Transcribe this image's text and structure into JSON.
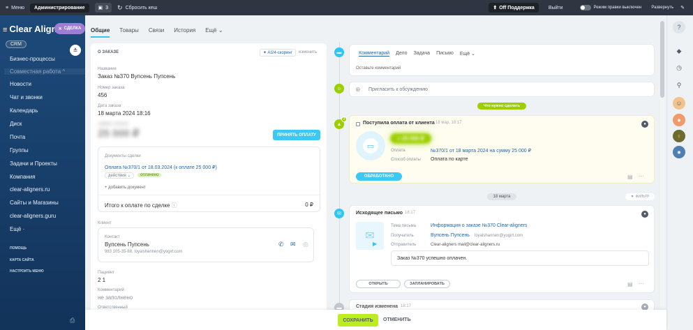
{
  "topbar": {
    "menu_label": "Меню",
    "admin_label": "Администрирование",
    "badge_count": "3",
    "reset_cache_label": "Сбросить кеш",
    "support_label": "Off Поддержка",
    "exit_label": "Выйти",
    "edit_mode_label": "Режим правки выключен",
    "expand_label": "Развернуть"
  },
  "sidebar": {
    "logo": "Clear Align",
    "deal_label": "СДЕЛКА",
    "crm_tag": "CRM",
    "items": [
      {
        "label": "Бизнес-процессы"
      },
      {
        "label": "Совместная работа ^"
      },
      {
        "label": "Новости"
      },
      {
        "label": "Чат и звонки"
      },
      {
        "label": "Календарь"
      },
      {
        "label": "Диск"
      },
      {
        "label": "Почта"
      },
      {
        "label": "Группы"
      },
      {
        "label": "Задачи и Проекты"
      },
      {
        "label": "Компания"
      },
      {
        "label": "clear-aligners.ru"
      },
      {
        "label": "Сайты и Магазины"
      },
      {
        "label": "clear-aligners.guru"
      },
      {
        "label": "Ещё ·"
      }
    ],
    "footer": [
      "ПОМОЩЬ",
      "КАРТА САЙТА",
      "НАСТРОИТЬ МЕНЮ"
    ]
  },
  "tabs": [
    "Общие",
    "Товары",
    "Связи",
    "История",
    "Ещё ⌄"
  ],
  "order": {
    "section_title": "О ЗАКАЗЕ",
    "ai_scoring": "AI24-скоринг",
    "edit_label": "изменить",
    "name_label": "Название",
    "name_value": "Заказ №370 Вупсень Пупсень",
    "number_label": "Номер заказа",
    "number_value": "456",
    "date_label": "Дата заказа",
    "date_value": "18 марта 2024 18:16",
    "sum_label": "Сумма к оплате",
    "sum_value": "25 000 ₽",
    "accept_payment": "ПРИНЯТЬ ОПЛАТУ",
    "docs_label": "Документы сделки",
    "doc_link": "Оплата №370/1 от 18.03.2024 (к оплате 25 000 ₽)",
    "doc_actions": "действия ⌄",
    "doc_status": "оплачено",
    "add_doc": "+ добавить документ",
    "total_label": "Итого к оплате по сделке",
    "total_value": "0 ₽",
    "client_label": "Клиент",
    "contact_label": "Контакт",
    "contact_name": "Вупсень Пупсень",
    "contact_details": "983 105-35-88, loyalshannen@yogirt.com",
    "patient_label": "Пациент",
    "patient_value": "2 1",
    "comment_label": "Комментарий",
    "comment_value": "не заполнено",
    "responsible_label": "Ответственный"
  },
  "activity": {
    "tabs": [
      "Комментарий",
      "Дело",
      "Задача",
      "Письмо",
      "Ещё ⌄"
    ],
    "placeholder": "Оставьте комментарий",
    "invite": "Пригласить к обсуждению",
    "todo_pill": "Что нужно сделать"
  },
  "payment_card": {
    "badge": "3",
    "title": "Поступила оплата от клиента",
    "time": "18 мар, 18:17",
    "amount": "+ 25 000 ₽",
    "payment_label": "Оплата",
    "payment_value": "№370/1 от 18 марта 2024 на сумму 25 000 ₽",
    "method_label": "Способ оплаты",
    "method_value": "Оплата по карте",
    "processed_button": "ОБРАБОТАНО"
  },
  "date_separator": "18 марта",
  "filter_label": "ФИЛЬТР",
  "email_card": {
    "title": "Исходящее письмо",
    "time": "18:17",
    "subject_label": "Тема письма",
    "subject_value": "Информация о заказе №370 Clear-aligners",
    "recipient_label": "Получатель",
    "recipient_name": "Вупсень Пупсень",
    "recipient_email": "loyalshannen@yogirt.com",
    "sender_label": "Отправитель",
    "sender_value": "Clear-aligners mail@clear-aligners.ru",
    "body": "Заказ №370 успешно оплачен.",
    "open_button": "ОТКРЫТЬ",
    "schedule_button": "ЗАПЛАНИРОВАТЬ"
  },
  "stage_card": {
    "title": "Стадия изменена",
    "time": "18:17"
  },
  "bottom": {
    "save": "СОХРАНИТЬ",
    "cancel": "ОТМЕНИТЬ"
  },
  "colors": {
    "accent": "#2fc6f6",
    "save_green": "#bbed21",
    "sidebar": "#1d4a7a",
    "timeline_green": "#9dcf00"
  }
}
